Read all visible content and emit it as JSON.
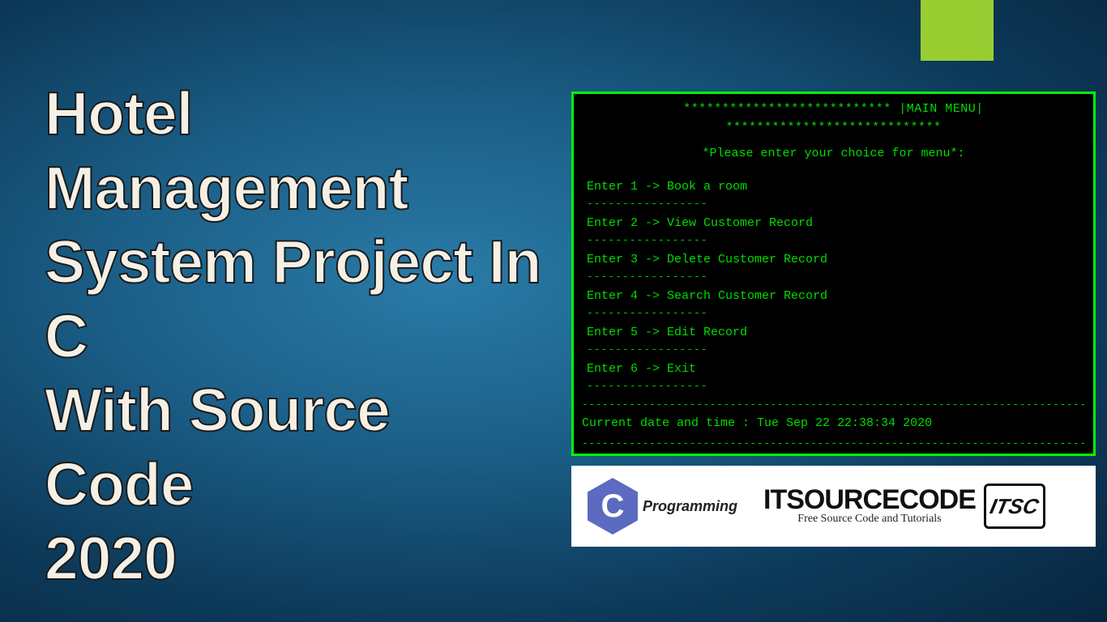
{
  "title": {
    "line1": "Hotel Management",
    "line2": "System Project  In C",
    "line3": "With Source Code",
    "line4": "2020"
  },
  "terminal": {
    "header": "***************************  |MAIN MENU|  ****************************",
    "prompt": "*Please enter your choice for menu*:",
    "items": [
      "Enter 1 -> Book a room",
      "Enter 2 -> View Customer Record",
      "Enter 3 -> Delete Customer Record",
      "Enter 4 -> Search Customer Record",
      "Enter 5 -> Edit Record",
      "Enter 6 -> Exit"
    ],
    "short_dash": "-----------------",
    "long_dash": "------------------------------------------------------------------------------------------",
    "datetime": "Current date and time : Tue Sep 22 22:38:34 2020"
  },
  "logos": {
    "c_letter": "C",
    "c_label": "Programming",
    "itsc_main": "ITSOURCECODE",
    "itsc_sub": "Free Source Code and Tutorials",
    "itsc_badge": "ITSC"
  }
}
